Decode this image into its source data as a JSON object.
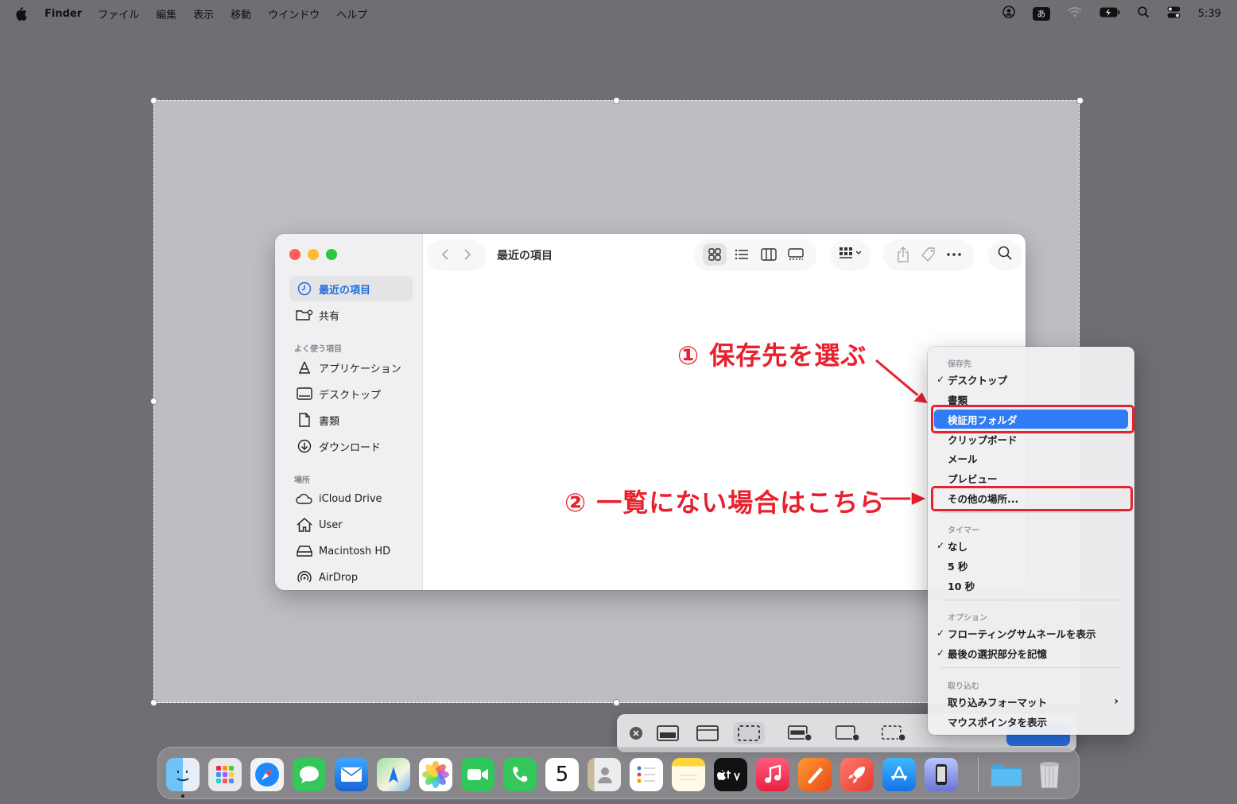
{
  "menubar": {
    "app_name": "Finder",
    "menus": [
      "ファイル",
      "編集",
      "表示",
      "移動",
      "ウインドウ",
      "ヘルプ"
    ],
    "ime_label": "あ",
    "clock": "5:39"
  },
  "finder": {
    "title": "最近の項目",
    "sidebar": {
      "top_items": [
        {
          "label": "最近の項目",
          "icon": "clock-icon",
          "active": true
        },
        {
          "label": "共有",
          "icon": "shared-folder-icon"
        }
      ],
      "favorites_header": "よく使う項目",
      "favorites": [
        {
          "label": "アプリケーション",
          "icon": "applications-icon"
        },
        {
          "label": "デスクトップ",
          "icon": "desktop-icon"
        },
        {
          "label": "書類",
          "icon": "document-icon"
        },
        {
          "label": "ダウンロード",
          "icon": "download-icon"
        }
      ],
      "locations_header": "場所",
      "locations": [
        {
          "label": "iCloud Drive",
          "icon": "cloud-icon"
        },
        {
          "label": "User",
          "icon": "home-icon"
        },
        {
          "label": "Macintosh HD",
          "icon": "disk-icon"
        },
        {
          "label": "AirDrop",
          "icon": "airdrop-icon"
        }
      ]
    }
  },
  "context_menu": {
    "save_header": "保存先",
    "save_items": [
      {
        "label": "デスクトップ",
        "checked": true
      },
      {
        "label": "書類",
        "checked": false
      },
      {
        "label": "検証用フォルダ",
        "checked": false,
        "highlighted": true
      },
      {
        "label": "クリップボード",
        "checked": false
      },
      {
        "label": "メール",
        "checked": false
      },
      {
        "label": "プレビュー",
        "checked": false
      },
      {
        "label": "その他の場所...",
        "checked": false
      }
    ],
    "timer_header": "タイマー",
    "timer_items": [
      {
        "label": "なし",
        "checked": true
      },
      {
        "label": "5 秒",
        "checked": false
      },
      {
        "label": "10 秒",
        "checked": false
      }
    ],
    "options_header": "オプション",
    "option_items": [
      {
        "label": "フローティングサムネールを表示",
        "checked": true
      },
      {
        "label": "最後の選択部分を記憶",
        "checked": true
      }
    ],
    "capture_header": "取り込む",
    "capture_items": [
      {
        "label": "取り込みフォーマット",
        "submenu": true
      },
      {
        "label": "マウスポインタを表示",
        "submenu": false
      }
    ]
  },
  "annotations": {
    "step1": "① 保存先を選ぶ",
    "step2": "② 一覧にない場合はこちら"
  },
  "colors": {
    "accent_red": "#e8212e",
    "highlight_blue": "#2f7cf6",
    "sidebar_active": "#1f6fe0"
  },
  "dock": {
    "calendar_day": "5",
    "apps": [
      "finder-icon",
      "launchpad-icon",
      "safari-icon",
      "messages-icon",
      "mail-icon",
      "maps-icon",
      "photos-icon",
      "facetime-icon",
      "phone-icon",
      "calendar-icon",
      "contacts-icon",
      "reminders-icon",
      "notes-icon",
      "tv-icon",
      "music-icon",
      "pages-icon",
      "rocket-icon",
      "app-store-icon",
      "iphone-mirroring-icon",
      "downloads-folder-icon",
      "trash-icon"
    ]
  }
}
